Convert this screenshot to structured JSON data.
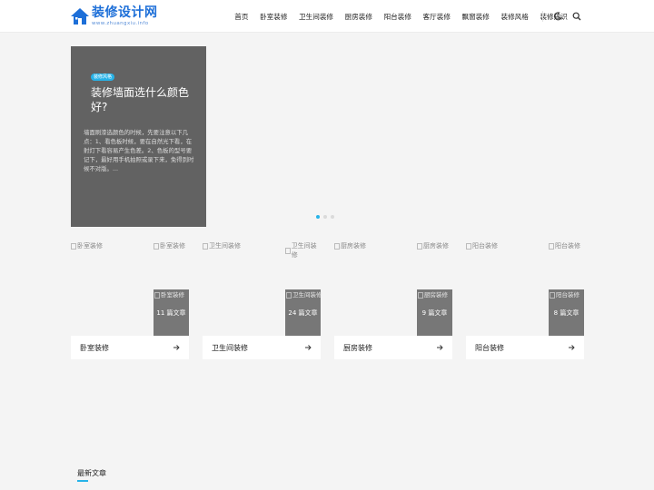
{
  "header": {
    "logo": {
      "title": "装修设计网",
      "subtitle": "www.zhuangxiu.info",
      "color": "#1d6fd8"
    },
    "nav": [
      "首页",
      "卧室装修",
      "卫生间装修",
      "厨房装修",
      "阳台装修",
      "客厅装修",
      "飘窗装修",
      "装修风格",
      "装修知识"
    ],
    "icons": [
      "moon-icon",
      "search-icon"
    ]
  },
  "slider": {
    "tag": "装修风格",
    "title": "装修墙面选什么颜色好?",
    "excerpt": "墙面刷漆选颜色的时候，先要注意以下几点：1、看色板时候，要在自然光下看，在射灯下看容易产生色差。2、色板的型号要记下，最好用手机拍照或录下来，免得到时候不对版。...",
    "dots": 3,
    "active_dot": 0,
    "accent": "#27b3e8"
  },
  "categories": [
    {
      "name": "卧室装修",
      "img_alt": "卧室装修",
      "count": "11 篇文章"
    },
    {
      "name": "卫生间装修",
      "img_alt": "卫生间装修",
      "count": "24 篇文章"
    },
    {
      "name": "厨房装修",
      "img_alt": "厨房装修",
      "count": "9 篇文章"
    },
    {
      "name": "阳台装修",
      "img_alt": "阳台装修",
      "count": "8 篇文章"
    }
  ],
  "latest": {
    "title": "最新文章"
  }
}
